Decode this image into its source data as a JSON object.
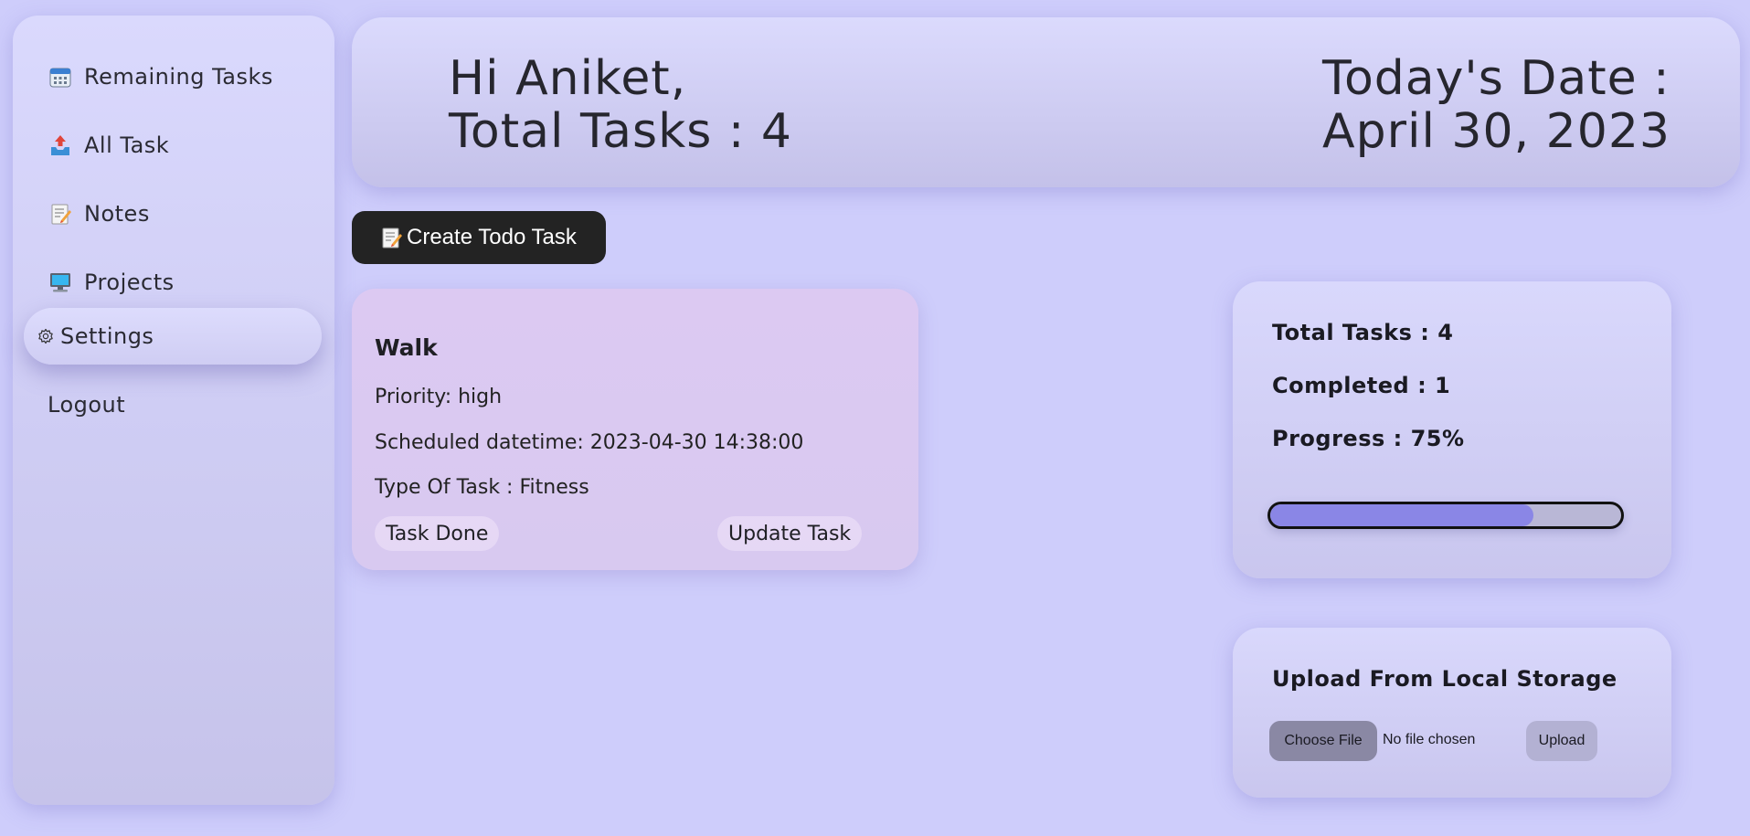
{
  "sidebar": {
    "items": [
      {
        "label": "Remaining Tasks",
        "icon": "calendar-icon"
      },
      {
        "label": "All Task",
        "icon": "inbox-tray-icon"
      },
      {
        "label": "Notes",
        "icon": "memo-icon"
      },
      {
        "label": "Projects",
        "icon": "computer-icon"
      },
      {
        "label": "Settings",
        "icon": "gear-icon"
      },
      {
        "label": "Logout"
      }
    ]
  },
  "header": {
    "greeting": "Hi Aniket,",
    "total_tasks": "Total Tasks : 4",
    "date_label": "Today's Date :",
    "date_value": "April 30, 2023"
  },
  "create_button": {
    "label": "Create Todo Task",
    "icon": "memo-icon"
  },
  "task": {
    "title": "Walk",
    "priority": "Priority: high",
    "scheduled": "Scheduled datetime: 2023-04-30 14:38:00",
    "type": "Type Of Task : Fitness",
    "done_label": "Task Done",
    "update_label": "Update Task"
  },
  "stats": {
    "total": "Total Tasks : 4",
    "completed": "Completed : 1",
    "progress": "Progress : 75%",
    "progress_value": 0.75
  },
  "upload": {
    "title": "Upload From Local Storage",
    "choose_label": "Choose File",
    "no_file": "No file chosen",
    "upload_label": "Upload"
  },
  "colors": {
    "background": "#cecdfb",
    "progress_fill": "#8a86e6",
    "button_dark": "#232323"
  }
}
